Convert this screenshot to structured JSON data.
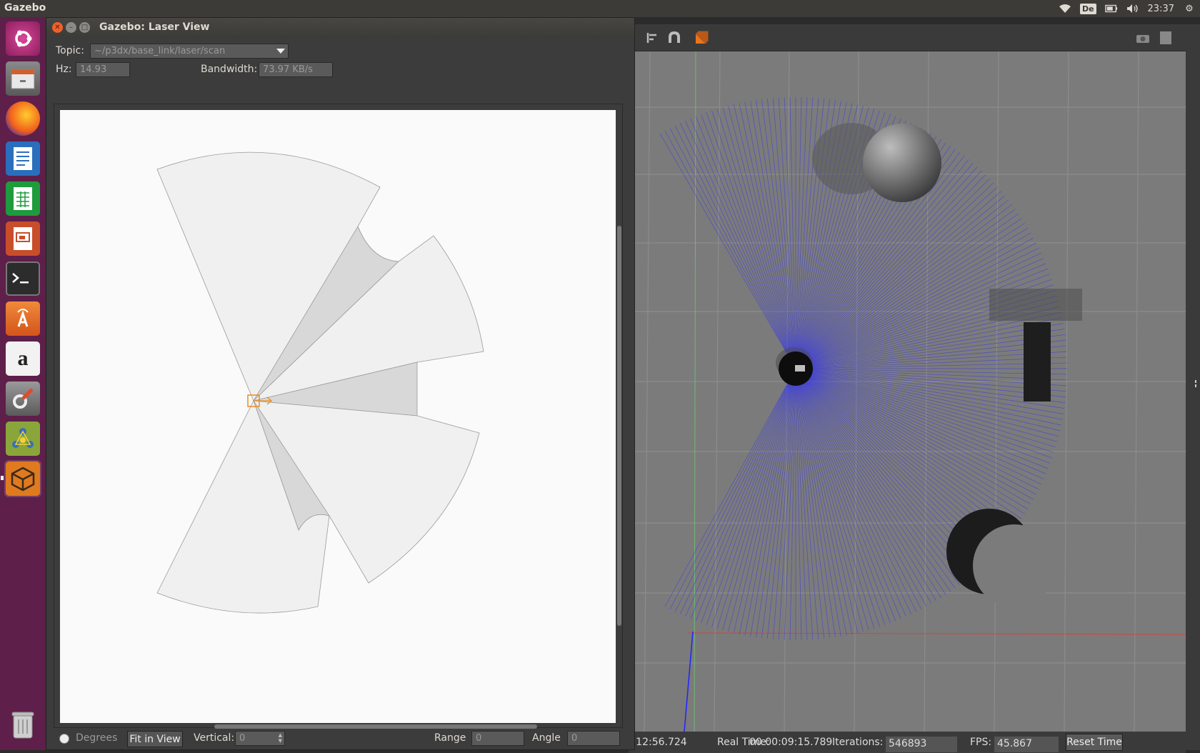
{
  "top_bar": {
    "app_name": "Gazebo",
    "keyboard_layout": "De",
    "clock": "23:37"
  },
  "launcher": {
    "items": [
      {
        "name": "Ubuntu Dash"
      },
      {
        "name": "Files"
      },
      {
        "name": "Firefox"
      },
      {
        "name": "LibreOffice Writer"
      },
      {
        "name": "LibreOffice Calc"
      },
      {
        "name": "LibreOffice Impress"
      },
      {
        "name": "Terminal"
      },
      {
        "name": "Ubuntu Software"
      },
      {
        "name": "Amazon"
      },
      {
        "name": "System Settings"
      },
      {
        "name": "ROS / RViz"
      },
      {
        "name": "Gazebo"
      },
      {
        "name": "Trash"
      }
    ]
  },
  "laser_window": {
    "title": "Gazebo: Laser View",
    "topic_label": "Topic:",
    "topic_value": "~/p3dx/base_link/laser/scan",
    "hz_label": "Hz:",
    "hz_value": "14.93",
    "bandwidth_label": "Bandwidth:",
    "bandwidth_value": "73.97 KB/s",
    "degrees_label": "Degrees",
    "fit_button": "Fit in View",
    "vertical_label": "Vertical:",
    "vertical_value": "0",
    "range_label": "Range",
    "range_value": "0",
    "angle_label": "Angle",
    "angle_value": "0"
  },
  "gazebo_status": {
    "sim_time_partial": "):12:56.724",
    "real_time_label": "Real Time:",
    "real_time_value": "00 00:09:15.789",
    "iterations_label": "Iterations:",
    "iterations_value": "546893",
    "fps_label": "FPS:",
    "fps_value": "45.867",
    "reset_button": "Reset Time"
  },
  "colors": {
    "launcher_bg": "#5e1f4a",
    "laser_ray": "#2a2aff",
    "close_button": "#f0602b",
    "sensor_marker": "#f08a1a"
  }
}
